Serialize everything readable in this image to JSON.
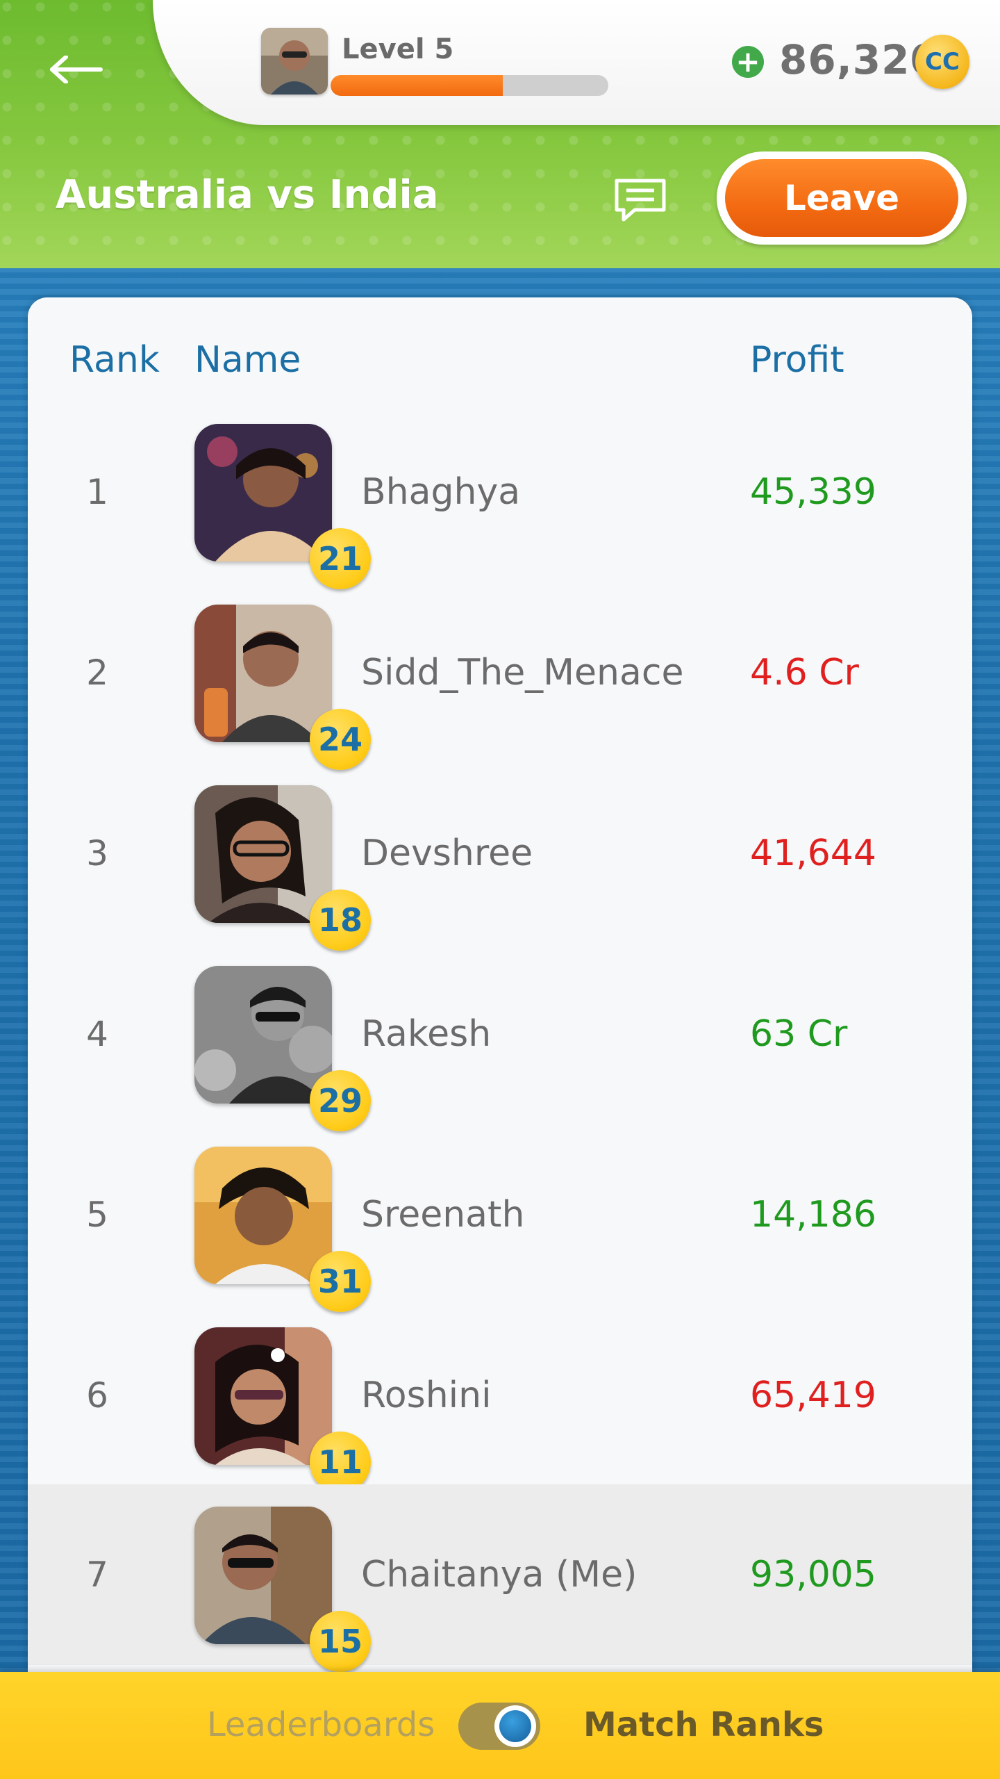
{
  "header": {
    "level_label": "Level 5",
    "level_progress": 0.62,
    "coins": "86,320",
    "currency_label": "CC",
    "match_title": "Australia vs India",
    "leave_label": "Leave"
  },
  "table": {
    "col_rank": "Rank",
    "col_name": "Name",
    "col_profit": "Profit",
    "rows": [
      {
        "rank": "1",
        "badge": "21",
        "name": "Bhaghya",
        "profit": "45,339",
        "profit_color": "#1f9a1f"
      },
      {
        "rank": "2",
        "badge": "24",
        "name": "Sidd_The_Menace",
        "profit": "4.6 Cr",
        "profit_color": "#e01f1f"
      },
      {
        "rank": "3",
        "badge": "18",
        "name": "Devshree",
        "profit": "41,644",
        "profit_color": "#e01f1f"
      },
      {
        "rank": "4",
        "badge": "29",
        "name": "Rakesh",
        "profit": "63 Cr",
        "profit_color": "#1f9a1f"
      },
      {
        "rank": "5",
        "badge": "31",
        "name": "Sreenath",
        "profit": "14,186",
        "profit_color": "#1f9a1f"
      },
      {
        "rank": "6",
        "badge": "11",
        "name": "Roshini",
        "profit": "65,419",
        "profit_color": "#e01f1f"
      },
      {
        "rank": "7",
        "badge": "15",
        "name": "Chaitanya (Me)",
        "profit": "93,005",
        "profit_color": "#1f9a1f"
      }
    ]
  },
  "bottom": {
    "leaderboards_label": "Leaderboards",
    "match_ranks_label": "Match Ranks"
  },
  "icons": {
    "back": "arrow-left-icon",
    "add": "plus-circle-icon",
    "coin": "cc-coin-icon",
    "chat": "chat-bubble-icon",
    "toggle": "toggle-switch"
  }
}
